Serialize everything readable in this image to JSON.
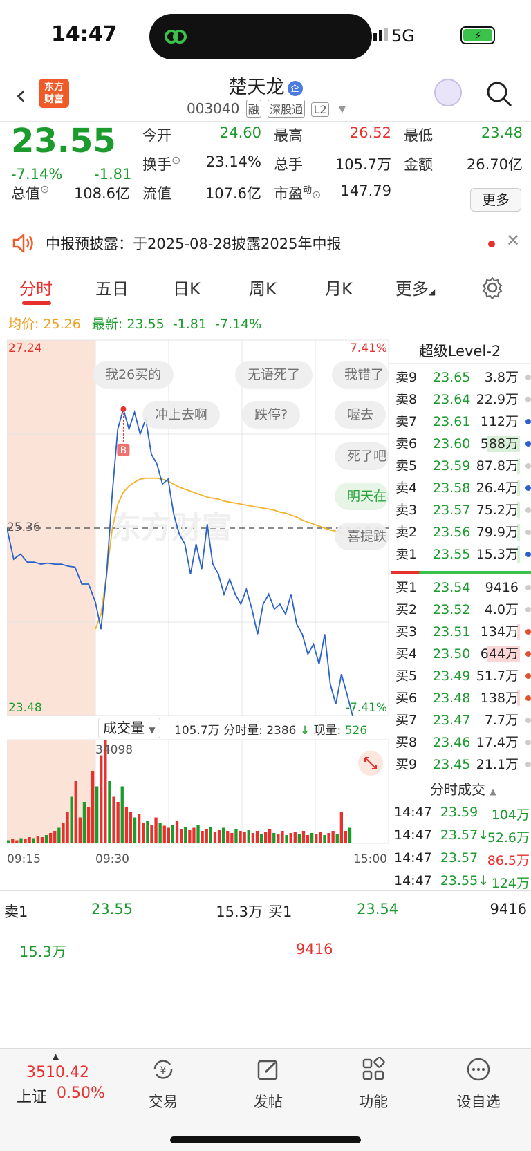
{
  "status_bar": {
    "time": "14:47",
    "network": "5G"
  },
  "header": {
    "brand": "东方\n财富",
    "stock_name": "楚天龙",
    "name_badge": "企",
    "code": "003040",
    "tags": [
      "融",
      "深股通",
      "L2"
    ]
  },
  "quote": {
    "price": "23.55",
    "change_pct": "-7.14%",
    "change": "-1.81",
    "fields": [
      {
        "label": "今开",
        "value": "24.60",
        "color": "green"
      },
      {
        "label": "最高",
        "value": "26.52",
        "color": "red"
      },
      {
        "label": "最低",
        "value": "23.48",
        "color": "green"
      },
      {
        "label": "换手",
        "value": "23.14%",
        "color": "dark"
      },
      {
        "label": "总手",
        "value": "105.7万",
        "color": "dark"
      },
      {
        "label": "金额",
        "value": "26.70亿",
        "color": "dark"
      },
      {
        "label": "总值",
        "value": "108.6亿",
        "color": "dark"
      },
      {
        "label": "流值",
        "value": "107.6亿",
        "color": "dark"
      },
      {
        "label": "市盈",
        "value": "147.79",
        "color": "dark"
      }
    ],
    "pe_superscript": "动",
    "more_button": "更多"
  },
  "notice": {
    "text": "中报预披露：于2025-08-28披露2025年中报"
  },
  "tabs": [
    "分时",
    "五日",
    "日K",
    "周K",
    "月K",
    "更多"
  ],
  "legend": {
    "avg_label": "均价:",
    "avg_value": "25.26",
    "latest_label": "最新:",
    "latest_value": "23.55",
    "latest_change": "-1.81",
    "latest_pct": "-7.14%"
  },
  "chart_data": {
    "type": "line",
    "x_labels": [
      "09:15",
      "09:30",
      "15:00"
    ],
    "y_top": "27.24",
    "y_bottom": "23.48",
    "y_mid": "25.36",
    "pct_top": "7.41%",
    "pct_bottom": "-7.41%",
    "ylim": [
      23.48,
      27.24
    ],
    "series": [
      {
        "name": "price",
        "color": "#2a62c9",
        "values": [
          25.36,
          25.05,
          25.1,
          25.02,
          25.02,
          25.0,
          25.01,
          25.0,
          25.0,
          24.98,
          24.97,
          24.8,
          24.8,
          24.62,
          24.35,
          24.9,
          25.7,
          26.35,
          26.55,
          26.35,
          26.52,
          26.3,
          26.45,
          26.1,
          26.0,
          25.8,
          25.85,
          25.5,
          25.3,
          25.2,
          24.9,
          25.2,
          24.95,
          25.4,
          25.0,
          24.9,
          24.7,
          24.85,
          24.7,
          24.6,
          24.75,
          24.55,
          24.3,
          24.6,
          24.7,
          24.55,
          24.6,
          24.5,
          24.7,
          24.4,
          24.3,
          24.1,
          24.2,
          24.0,
          24.3,
          23.8,
          23.6,
          23.9,
          23.7,
          23.48
        ]
      },
      {
        "name": "avg",
        "color": "#f3b22c",
        "values": [
          null,
          null,
          null,
          null,
          null,
          null,
          null,
          null,
          null,
          null,
          null,
          null,
          null,
          24.35,
          24.5,
          24.9,
          25.35,
          25.6,
          25.72,
          25.78,
          25.82,
          25.85,
          25.86,
          25.86,
          25.86,
          25.85,
          25.83,
          25.8,
          25.77,
          25.75,
          25.73,
          25.71,
          25.69,
          25.67,
          25.66,
          25.65,
          25.63,
          25.62,
          25.61,
          25.6,
          25.59,
          25.58,
          25.57,
          25.56,
          25.55,
          25.54,
          25.52,
          25.51,
          25.49,
          25.47,
          25.44,
          25.42,
          25.4,
          25.38,
          25.36,
          25.34,
          25.33,
          25.31,
          25.29,
          25.26
        ]
      }
    ],
    "peak_marker": "B"
  },
  "bubbles": [
    "我26买的",
    "无语死了",
    "我错了",
    "冲上去啊",
    "跌停?",
    "喔去",
    "死了吧",
    "明天在",
    "喜提跌"
  ],
  "volume": {
    "selector": "成交量",
    "total": "105.7万",
    "fenshi_label": "分时量:",
    "fenshi_value": "2386",
    "arrow": "↓",
    "now_label": "现量:",
    "now_value": "526",
    "max_label": "34098",
    "bars": [
      3,
      4,
      3,
      5,
      4,
      6,
      5,
      7,
      6,
      8,
      10,
      12,
      15,
      20,
      30,
      45,
      60,
      25,
      40,
      35,
      70,
      55,
      85,
      100,
      60,
      45,
      40,
      55,
      35,
      30,
      25,
      28,
      20,
      22,
      18,
      25,
      20,
      17,
      15,
      18,
      22,
      14,
      16,
      13,
      15,
      18,
      12,
      14,
      16,
      11,
      13,
      15,
      12,
      10,
      14,
      12,
      11,
      13,
      10,
      12,
      9,
      11,
      14,
      10,
      9,
      12,
      8,
      10,
      11,
      9,
      12,
      8,
      10,
      9,
      11,
      8,
      10,
      12,
      9,
      30,
      12,
      15
    ]
  },
  "level2": {
    "title": "超级Level-2",
    "asks": [
      {
        "label": "卖9",
        "price": "23.65",
        "vol": "3.8万"
      },
      {
        "label": "卖8",
        "price": "23.64",
        "vol": "22.9万"
      },
      {
        "label": "卖7",
        "price": "23.61",
        "vol": "112万"
      },
      {
        "label": "卖6",
        "price": "23.60",
        "vol": "588万"
      },
      {
        "label": "卖5",
        "price": "23.59",
        "vol": "87.8万"
      },
      {
        "label": "卖4",
        "price": "23.58",
        "vol": "26.4万"
      },
      {
        "label": "卖3",
        "price": "23.57",
        "vol": "75.2万"
      },
      {
        "label": "卖2",
        "price": "23.56",
        "vol": "79.9万"
      },
      {
        "label": "卖1",
        "price": "23.55",
        "vol": "15.3万"
      }
    ],
    "bids": [
      {
        "label": "买1",
        "price": "23.54",
        "vol": "9416"
      },
      {
        "label": "买2",
        "price": "23.52",
        "vol": "4.0万"
      },
      {
        "label": "买3",
        "price": "23.51",
        "vol": "134万"
      },
      {
        "label": "买4",
        "price": "23.50",
        "vol": "644万"
      },
      {
        "label": "买5",
        "price": "23.49",
        "vol": "51.7万"
      },
      {
        "label": "买6",
        "price": "23.48",
        "vol": "138万"
      },
      {
        "label": "买7",
        "price": "23.47",
        "vol": "7.7万"
      },
      {
        "label": "买8",
        "price": "23.46",
        "vol": "17.4万"
      },
      {
        "label": "买9",
        "price": "23.45",
        "vol": "21.1万"
      }
    ],
    "trades_title": "分时成交",
    "trades": [
      {
        "time": "14:47",
        "price": "23.59",
        "vol": "104万",
        "dir": ""
      },
      {
        "time": "14:47",
        "price": "23.57",
        "vol": "52.6万",
        "dir": "↓"
      },
      {
        "time": "14:47",
        "price": "23.57",
        "vol": "86.5万",
        "dir": ""
      },
      {
        "time": "14:47",
        "price": "23.55",
        "vol": "124万",
        "dir": "↓"
      }
    ]
  },
  "bottom_table": {
    "sell_label": "卖1",
    "sell_price": "23.55",
    "sell_vol": "15.3万",
    "buy_label": "买1",
    "buy_price": "23.54",
    "buy_vol": "9416",
    "sell_detail": "15.3万",
    "buy_detail": "9416"
  },
  "nav": {
    "index_value": "3510.42",
    "index_name": "上证",
    "index_pct": "0.50%",
    "items": [
      "交易",
      "发帖",
      "功能",
      "设自选"
    ]
  }
}
